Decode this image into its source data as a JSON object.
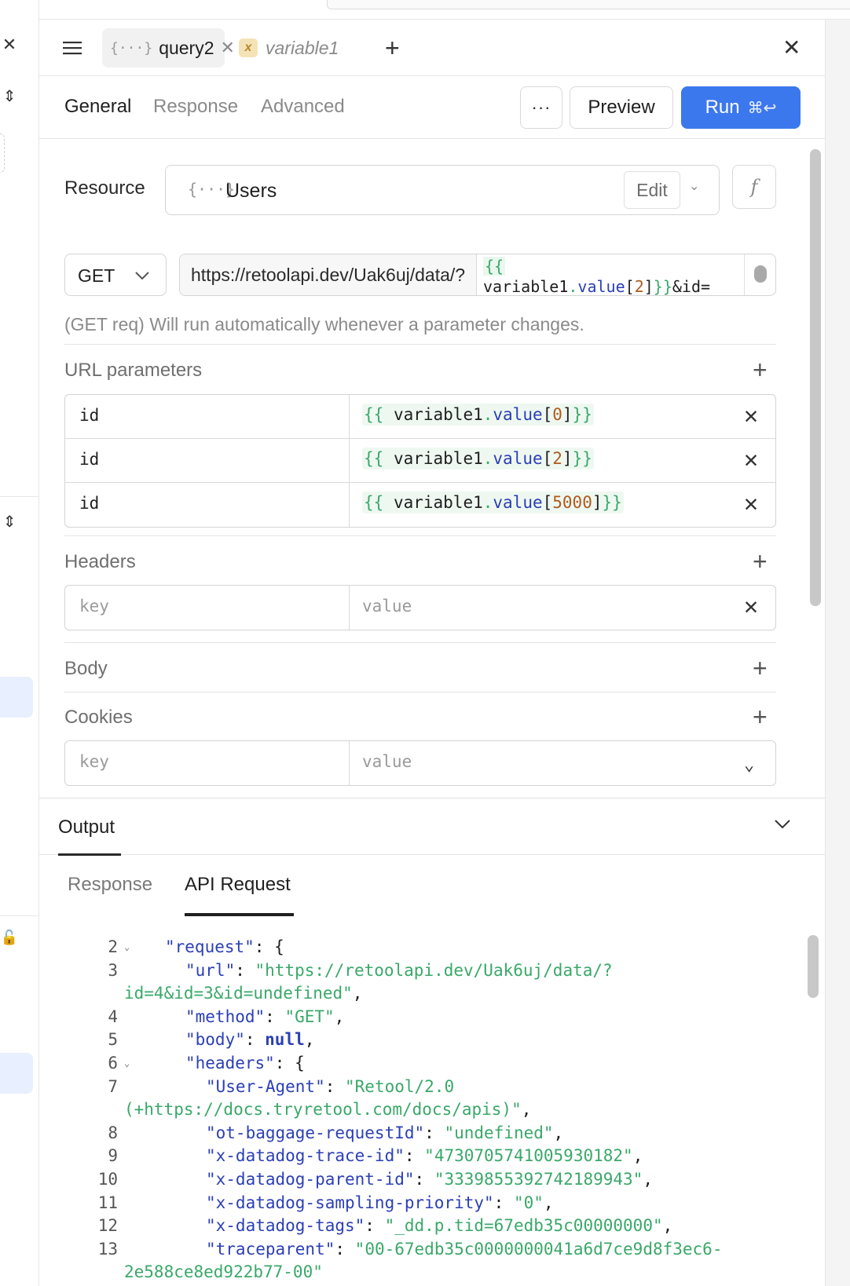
{
  "tabs": [
    {
      "name": "query2",
      "icon": "api-resource-icon",
      "active": true
    },
    {
      "name": "variable1",
      "icon": "variable-icon",
      "active": false
    }
  ],
  "section_tabs": [
    "General",
    "Response",
    "Advanced"
  ],
  "actions": {
    "more": "···",
    "preview": "Preview",
    "run": "Run",
    "run_shortcut": "⌘↩"
  },
  "resource": {
    "label": "Resource",
    "name": "Users",
    "edit": "Edit"
  },
  "request": {
    "method": "GET",
    "url_base": "https://retoolapi.dev/Uak6uj/data/?",
    "url_template_line1": "{{",
    "url_template_line2_var": "variable1",
    "url_template_line2_prop": "value",
    "url_template_line2_idx": "2",
    "url_template_line2_tail": "&id=",
    "hint": "(GET req) Will run automatically whenever a parameter changes."
  },
  "url_parameters": {
    "title": "URL parameters",
    "rows": [
      {
        "key": "id",
        "var": "variable1",
        "prop": "value",
        "index": "0"
      },
      {
        "key": "id",
        "var": "variable1",
        "prop": "value",
        "index": "2"
      },
      {
        "key": "id",
        "var": "variable1",
        "prop": "value",
        "index": "5000"
      }
    ]
  },
  "headers": {
    "title": "Headers",
    "key_placeholder": "key",
    "value_placeholder": "value"
  },
  "body": {
    "title": "Body"
  },
  "cookies": {
    "title": "Cookies",
    "key_placeholder": "key",
    "value_placeholder": "value"
  },
  "output": {
    "title": "Output",
    "tabs": [
      "Response",
      "API Request"
    ],
    "active_tab": "API Request",
    "code_lines": [
      {
        "n": "2",
        "fold": true,
        "indent": 1,
        "parts": [
          [
            "k",
            "\"request\""
          ],
          [
            "pun",
            ": {"
          ]
        ]
      },
      {
        "n": "3",
        "fold": false,
        "indent": 2,
        "parts": [
          [
            "k",
            "\"url\""
          ],
          [
            "pun",
            ": "
          ],
          [
            "s",
            "\"https://retoolapi.dev/Uak6uj/data/?"
          ]
        ]
      },
      {
        "n": "",
        "fold": false,
        "indent": 0,
        "parts": [
          [
            "s",
            "id=4&id=3&id=undefined\""
          ],
          [
            "pun",
            ","
          ]
        ]
      },
      {
        "n": "4",
        "fold": false,
        "indent": 2,
        "parts": [
          [
            "k",
            "\"method\""
          ],
          [
            "pun",
            ": "
          ],
          [
            "s",
            "\"GET\""
          ],
          [
            "pun",
            ","
          ]
        ]
      },
      {
        "n": "5",
        "fold": false,
        "indent": 2,
        "parts": [
          [
            "k",
            "\"body\""
          ],
          [
            "pun",
            ": "
          ],
          [
            "kw",
            "null"
          ],
          [
            "pun",
            ","
          ]
        ]
      },
      {
        "n": "6",
        "fold": true,
        "indent": 2,
        "parts": [
          [
            "k",
            "\"headers\""
          ],
          [
            "pun",
            ": {"
          ]
        ]
      },
      {
        "n": "7",
        "fold": false,
        "indent": 3,
        "parts": [
          [
            "k",
            "\"User-Agent\""
          ],
          [
            "pun",
            ": "
          ],
          [
            "s",
            "\"Retool/2.0"
          ]
        ]
      },
      {
        "n": "",
        "fold": false,
        "indent": 0,
        "parts": [
          [
            "s",
            "(+https://docs.tryretool.com/docs/apis)\""
          ],
          [
            "pun",
            ","
          ]
        ]
      },
      {
        "n": "8",
        "fold": false,
        "indent": 3,
        "parts": [
          [
            "k",
            "\"ot-baggage-requestId\""
          ],
          [
            "pun",
            ": "
          ],
          [
            "s",
            "\"undefined\""
          ],
          [
            "pun",
            ","
          ]
        ]
      },
      {
        "n": "9",
        "fold": false,
        "indent": 3,
        "parts": [
          [
            "k",
            "\"x-datadog-trace-id\""
          ],
          [
            "pun",
            ": "
          ],
          [
            "s",
            "\"4730705741005930182\""
          ],
          [
            "pun",
            ","
          ]
        ]
      },
      {
        "n": "10",
        "fold": false,
        "indent": 3,
        "parts": [
          [
            "k",
            "\"x-datadog-parent-id\""
          ],
          [
            "pun",
            ": "
          ],
          [
            "s",
            "\"3339855392742189943\""
          ],
          [
            "pun",
            ","
          ]
        ]
      },
      {
        "n": "11",
        "fold": false,
        "indent": 3,
        "parts": [
          [
            "k",
            "\"x-datadog-sampling-priority\""
          ],
          [
            "pun",
            ": "
          ],
          [
            "s",
            "\"0\""
          ],
          [
            "pun",
            ","
          ]
        ]
      },
      {
        "n": "12",
        "fold": false,
        "indent": 3,
        "parts": [
          [
            "k",
            "\"x-datadog-tags\""
          ],
          [
            "pun",
            ": "
          ],
          [
            "s",
            "\"_dd.p.tid=67edb35c00000000\""
          ],
          [
            "pun",
            ","
          ]
        ]
      },
      {
        "n": "13",
        "fold": false,
        "indent": 3,
        "parts": [
          [
            "k",
            "\"traceparent\""
          ],
          [
            "pun",
            ": "
          ],
          [
            "s",
            "\"00-67edb35c0000000041a6d7ce9d8f3ec6-"
          ]
        ]
      },
      {
        "n": "",
        "fold": false,
        "indent": 0,
        "parts": [
          [
            "s",
            "2e588ce8ed922b77-00\""
          ]
        ]
      }
    ]
  },
  "colors": {
    "accent": "#3c78ed",
    "string": "#3aa869",
    "key": "#2b3fb4",
    "number": "#b05a1e"
  }
}
